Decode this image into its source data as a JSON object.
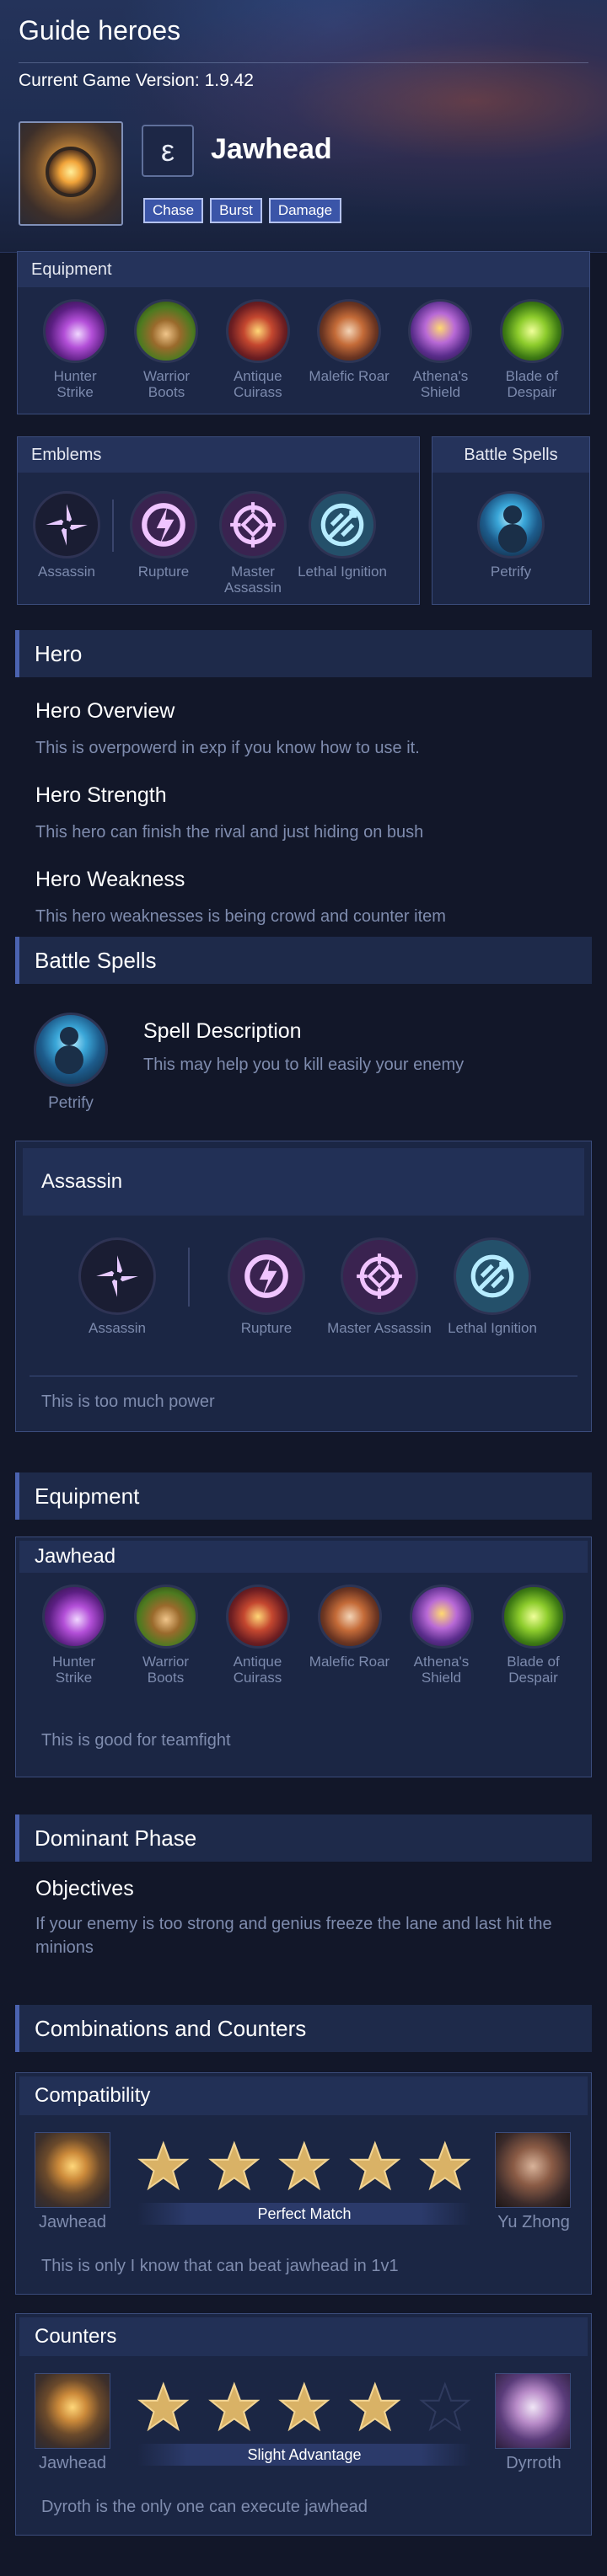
{
  "header": {
    "title": "Guide heroes",
    "version": "Current Game Version: 1.9.42",
    "hero_name": "Jawhead",
    "role_glyph": "ε",
    "tags": [
      "Chase",
      "Burst",
      "Damage"
    ]
  },
  "equipment_panel": {
    "title": "Equipment",
    "items": [
      {
        "name": "Hunter Strike",
        "icon": "hunter-strike-icon"
      },
      {
        "name": "Warrior Boots",
        "icon": "warrior-boots-icon"
      },
      {
        "name": "Antique Cuirass",
        "icon": "antique-cuirass-icon"
      },
      {
        "name": "Malefic Roar",
        "icon": "malefic-roar-icon"
      },
      {
        "name": "Athena's Shield",
        "icon": "athenas-shield-icon"
      },
      {
        "name": "Blade of Despair",
        "icon": "blade-of-despair-icon"
      }
    ]
  },
  "emblems_panel": {
    "title": "Emblems",
    "main": "Assassin",
    "talents": [
      "Rupture",
      "Master Assassin",
      "Lethal Ignition"
    ]
  },
  "spells_panel": {
    "title": "Battle Spells",
    "spell": "Petrify"
  },
  "hero_section": {
    "title": "Hero",
    "overview_title": "Hero Overview",
    "overview_text": "This is overpowerd in exp if you know how to use it.",
    "strength_title": "Hero Strength",
    "strength_text": "This hero can finish the rival and just hiding on bush",
    "weakness_title": "Hero Weakness",
    "weakness_text": "This hero weaknesses is being crowd and counter item"
  },
  "battle_spells_section": {
    "title": "Battle Spells",
    "spell": "Petrify",
    "desc_title": "Spell Description",
    "desc_text": "This may help you to kill easily your enemy"
  },
  "emblem_section": {
    "title": "Assassin",
    "main": "Assassin",
    "talents": [
      "Rupture",
      "Master Assassin",
      "Lethal Ignition"
    ],
    "note": "This is too much power"
  },
  "equipment_section": {
    "title": "Equipment",
    "build_title": "Jawhead",
    "items": [
      "Hunter Strike",
      "Warrior Boots",
      "Antique Cuirass",
      "Malefic Roar",
      "Athena's Shield",
      "Blade of Despair"
    ],
    "note": "This is good for teamfight"
  },
  "dominant_phase": {
    "title": "Dominant Phase",
    "sub": "Objectives",
    "text": "If your enemy is too strong and genius freeze the lane and last hit the minions"
  },
  "combos": {
    "title": "Combinations and Counters",
    "compat": {
      "title": "Compatibility",
      "left": "Jawhead",
      "right": "Yu Zhong",
      "rating": 5,
      "max": 5,
      "label": "Perfect Match",
      "note": "This is only I know that can beat jawhead in 1v1"
    },
    "counters": {
      "title": "Counters",
      "left": "Jawhead",
      "right": "Dyrroth",
      "rating": 4,
      "max": 5,
      "label": "Slight Advantage",
      "note": "Dyroth is the only one can execute jawhead"
    }
  },
  "colors": {
    "background": "#121729",
    "panel": "#1c2746",
    "accent": "#4b63b0",
    "tag": "#3b55a8",
    "star_gold": "#d9b266"
  }
}
